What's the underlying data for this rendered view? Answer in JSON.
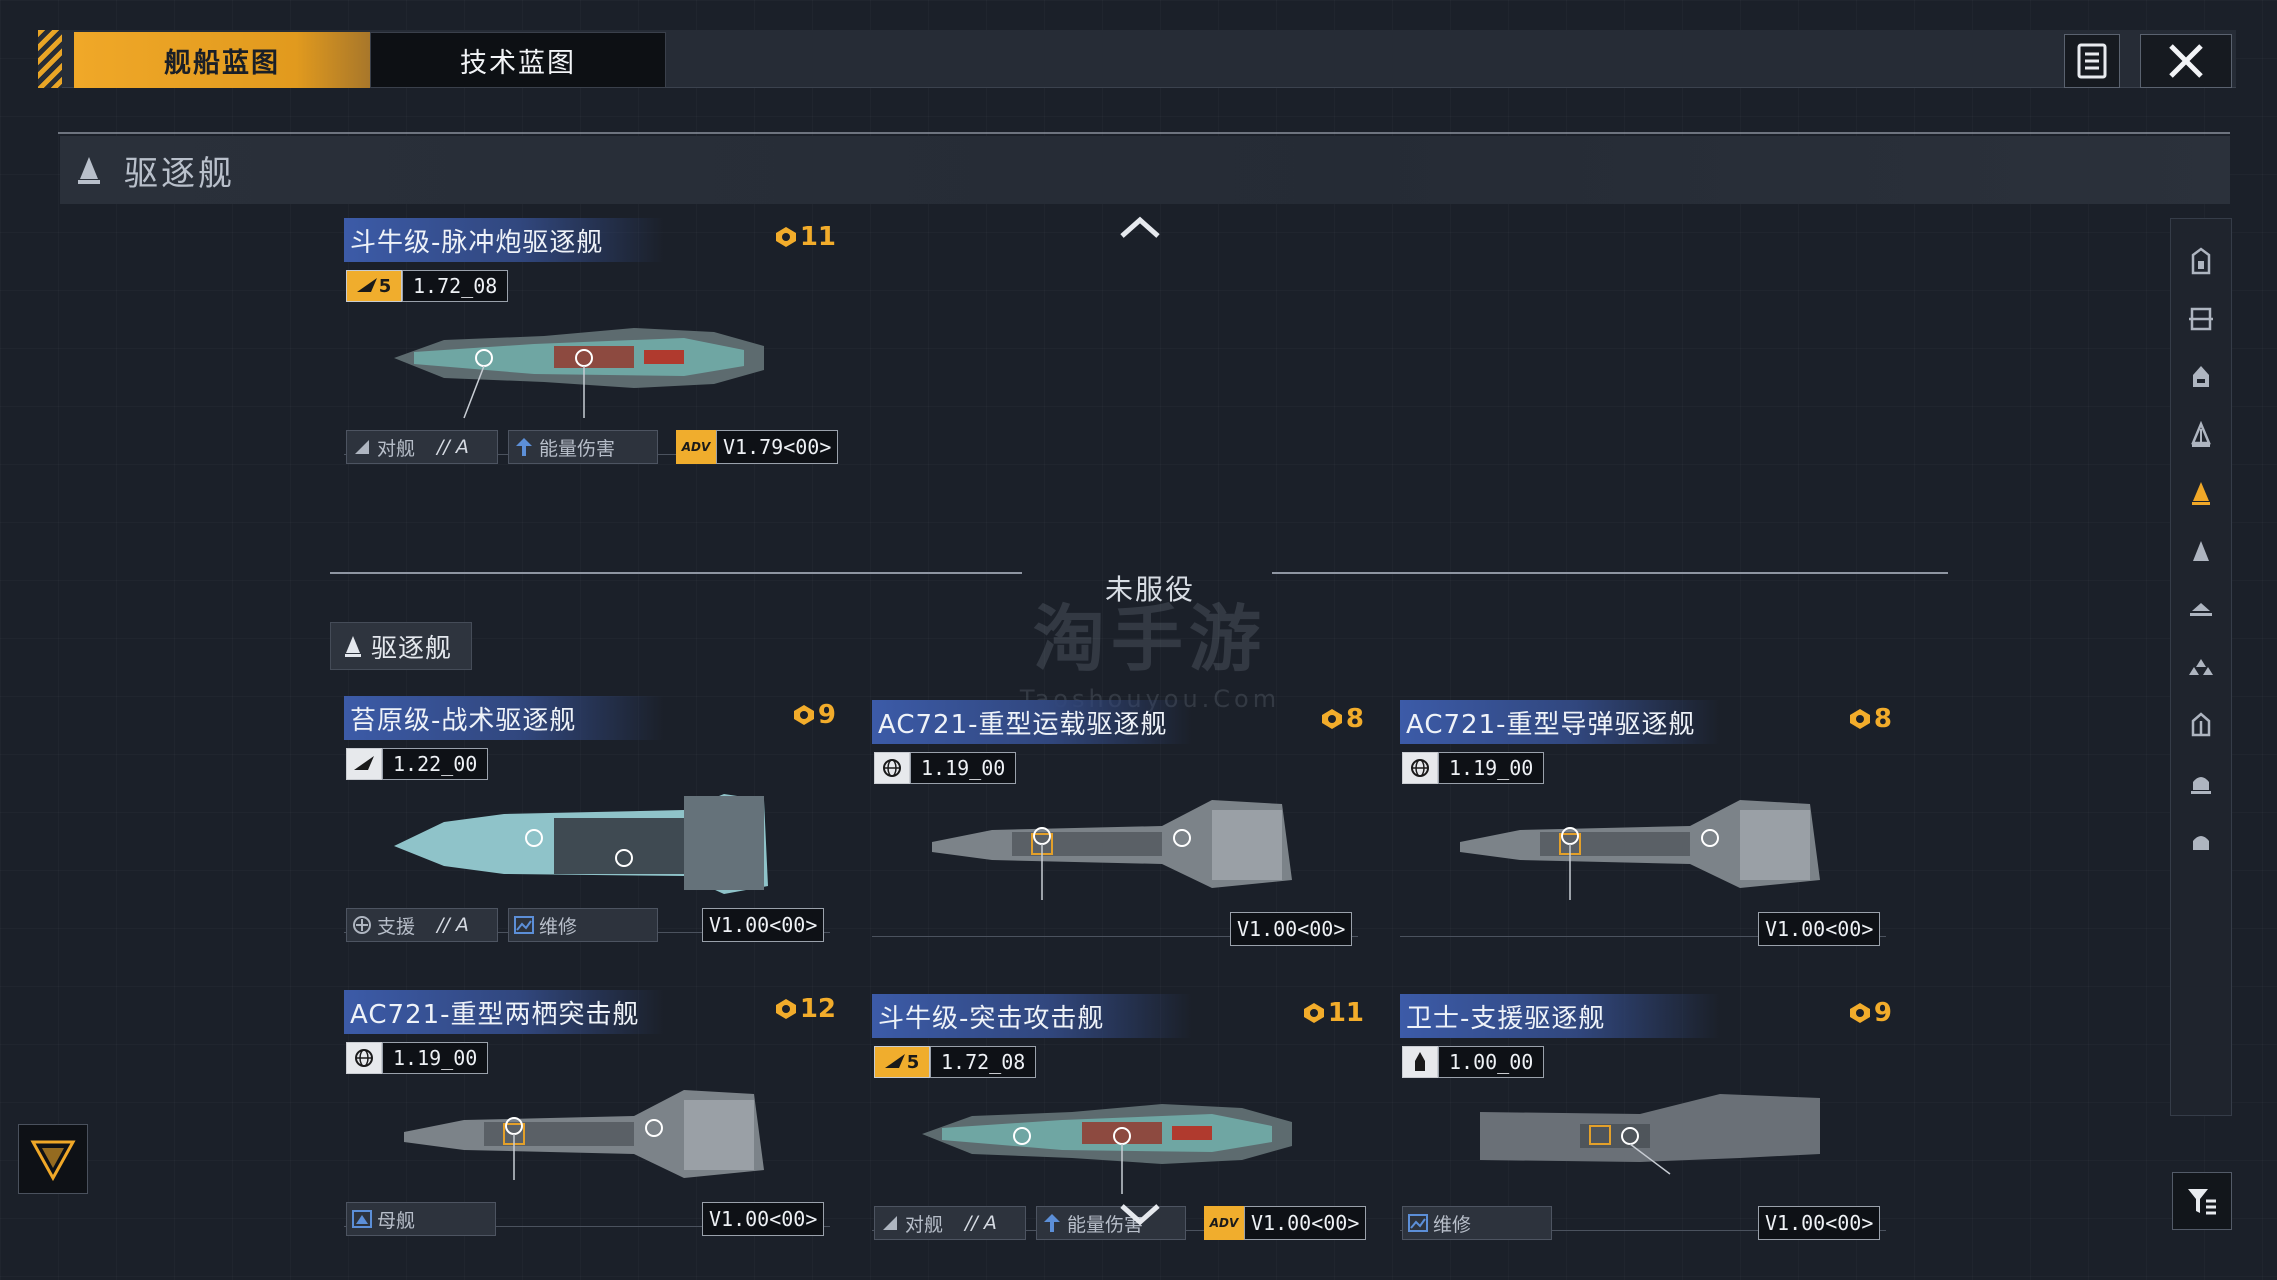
{
  "tabs": [
    {
      "label": "舰船蓝图",
      "active": true
    },
    {
      "label": "技术蓝图",
      "active": false
    }
  ],
  "section": {
    "title": "驱逐舰"
  },
  "divider": {
    "label": "未服役"
  },
  "subcategory": {
    "label": "驱逐舰"
  },
  "watermark": {
    "main": "淘手游",
    "sub": "Taoshouyou.Com"
  },
  "active_ship": {
    "name": "斗牛级-脉冲炮驱逐舰",
    "cost": "11",
    "badge": "5",
    "version": "1.72_08",
    "role": "对舰",
    "grade": "// A",
    "tag": "能量伤害",
    "adv_version": "V1.79<00>"
  },
  "ships": [
    {
      "name": "苔原级-战术驱逐舰",
      "cost": "9",
      "version": "1.22_00",
      "role": "支援",
      "grade": "// A",
      "tag": "维修",
      "adv_version": "V1.00<00>"
    },
    {
      "name": "AC721-重型运载驱逐舰",
      "cost": "8",
      "version": "1.19_00",
      "adv_version": "V1.00<00>"
    },
    {
      "name": "AC721-重型导弹驱逐舰",
      "cost": "8",
      "version": "1.19_00",
      "adv_version": "V1.00<00>"
    },
    {
      "name": "AC721-重型两栖突击舰",
      "cost": "12",
      "version": "1.19_00",
      "role": "母舰",
      "adv_version": "V1.00<00>"
    },
    {
      "name": "斗牛级-突击攻击舰",
      "cost": "11",
      "badge": "5",
      "version": "1.72_08",
      "role": "对舰",
      "grade": "// A",
      "tag": "能量伤害",
      "adv_version": "V1.00<00>"
    },
    {
      "name": "卫士-支援驱逐舰",
      "cost": "9",
      "version": "1.00_00",
      "role": "维修",
      "adv_version": "V1.00<00>"
    }
  ],
  "colors": {
    "accent": "#f0a828",
    "name_bar": "#3c5ba8",
    "background": "#1b2029"
  },
  "icons": {
    "list": "list-icon",
    "close": "close-icon",
    "filter": "filter-icon",
    "scroll_up": "chevron-up-icon",
    "scroll_down": "chevron-down-icon"
  },
  "sidebar_icons": [
    "battleship-icon",
    "carrier-icon",
    "cruiser-icon",
    "frigate-light-icon",
    "destroyer-icon",
    "frigate-icon",
    "corvette-icon",
    "fighter-icon",
    "station-icon",
    "cargo-icon",
    "auxiliary-icon"
  ]
}
